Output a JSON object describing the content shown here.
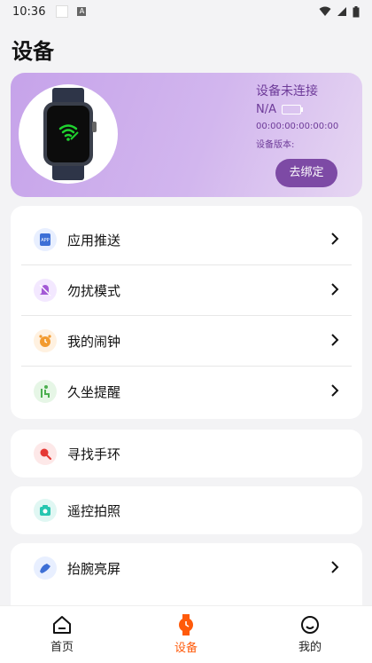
{
  "status": {
    "time": "10:36"
  },
  "title": "设备",
  "device": {
    "status": "设备未连接",
    "battery": "N/A",
    "mac": "00:00:00:00:00:00",
    "version_label": "设备版本:",
    "unbind_label": "去绑定"
  },
  "menu_group1": [
    {
      "label": "应用推送",
      "icon": "app-push-icon",
      "color": "#3d6fd6"
    },
    {
      "label": "勿扰模式",
      "icon": "do-not-disturb-icon",
      "color": "#a35ad6"
    },
    {
      "label": "我的闹钟",
      "icon": "alarm-icon",
      "color": "#f29a2e"
    },
    {
      "label": "久坐提醒",
      "icon": "sedentary-reminder-icon",
      "color": "#4caf50"
    }
  ],
  "menu_find": {
    "label": "寻找手环",
    "icon": "find-band-icon",
    "color": "#e53935"
  },
  "menu_remote": {
    "label": "遥控拍照",
    "icon": "remote-camera-icon",
    "color": "#26c6b0"
  },
  "menu_raise": {
    "label": "抬腕亮屏",
    "icon": "raise-wrist-icon",
    "color": "#3d6fd6"
  },
  "nav": [
    {
      "label": "首页",
      "icon": "home-icon"
    },
    {
      "label": "设备",
      "icon": "device-watch-icon"
    },
    {
      "label": "我的",
      "icon": "profile-icon"
    }
  ],
  "colors": {
    "accent": "#ff5a0a",
    "card_purple": "#c6a3ea",
    "button_purple": "#7d4aa5"
  }
}
